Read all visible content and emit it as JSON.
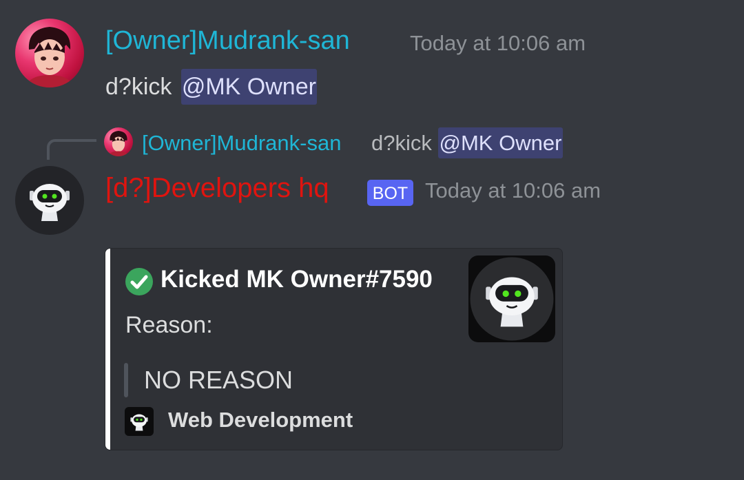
{
  "messages": [
    {
      "author": "[Owner]Mudrank-san",
      "timestamp": "Today at 10:06 am",
      "content_prefix": "d?kick ",
      "mention": "@MK Owner",
      "author_color": "#1fb6d6"
    },
    {
      "reply": {
        "author": "[Owner]Mudrank-san",
        "content_prefix": "d?kick",
        "mention": "@MK Owner"
      },
      "author": "[d?]Developers hq",
      "badge": "BOT",
      "timestamp": "Today at 10:06 am",
      "author_color": "#e0140f",
      "embed": {
        "title": "Kicked MK Owner#7590",
        "title_icon": "check-circle-icon",
        "field_label": "Reason:",
        "quote": "NO REASON",
        "footer": "Web Development",
        "accent_color": "#ffffff",
        "thumbnail": "robot-icon"
      }
    }
  ],
  "colors": {
    "background": "#36393f",
    "mention_bg": "#3e4271",
    "bot_badge": "#5865f2",
    "check": "#3ba55d"
  }
}
